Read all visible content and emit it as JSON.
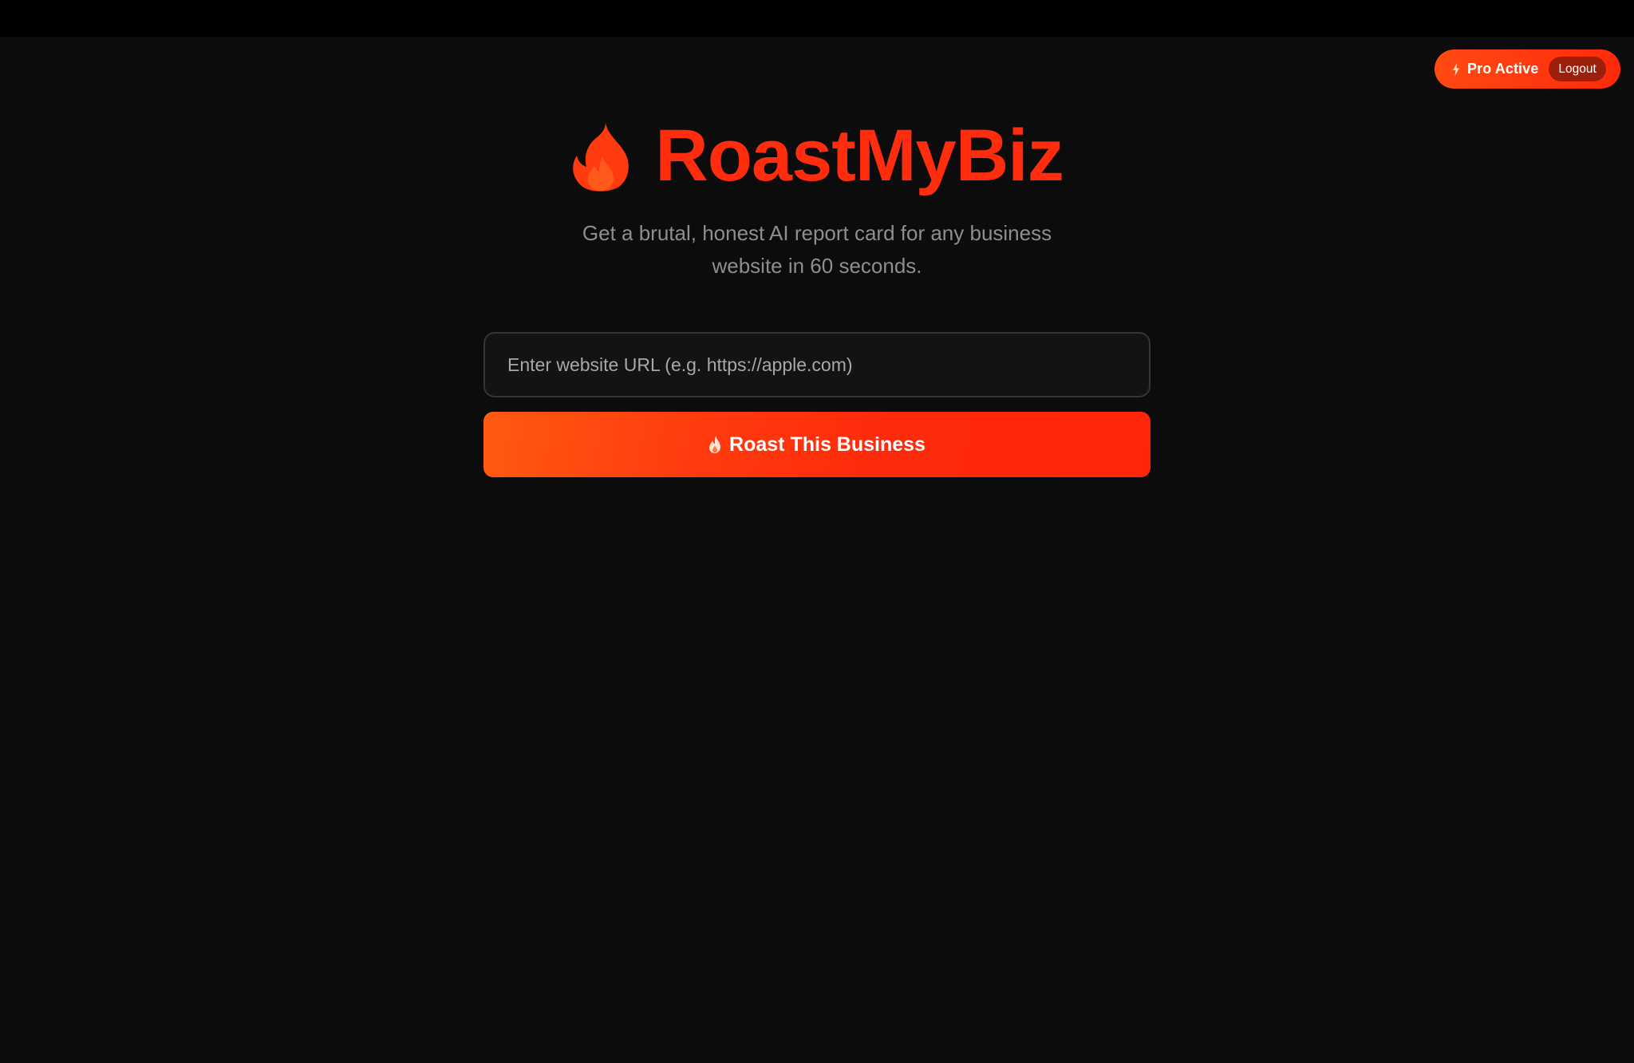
{
  "header": {
    "pro_badge_label": "Pro Active",
    "logout_label": "Logout"
  },
  "hero": {
    "brand": "RoastMyBiz",
    "subtitle": "Get a brutal, honest AI report card for any business website in 60 seconds."
  },
  "form": {
    "url_placeholder": "Enter website URL (e.g. https://apple.com)",
    "url_value": "",
    "submit_label": "Roast This Business"
  },
  "icons": {
    "badge": "lightning-bolt-icon",
    "logo": "fire-icon",
    "button": "fire-icon"
  },
  "colors": {
    "background": "#0c0c0c",
    "accent": "#ff2d0d",
    "accent_light": "#ff5a12",
    "subtitle_text": "#8e8e8e",
    "input_border": "#353535",
    "logout_bg": "#9c1f0b"
  }
}
